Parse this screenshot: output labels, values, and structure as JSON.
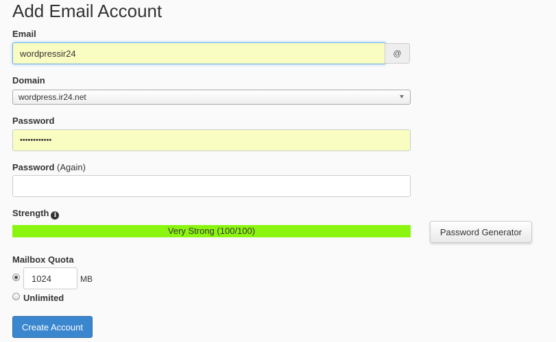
{
  "page": {
    "title": "Add Email Account"
  },
  "email": {
    "label": "Email",
    "value": "wordpressir24",
    "addon": "@"
  },
  "domain": {
    "label": "Domain",
    "selected": "wordpress.ir24.net"
  },
  "password": {
    "label": "Password",
    "value": "••••••••••••"
  },
  "password_again": {
    "label_main": "Password",
    "label_suffix": "(Again)",
    "value": ""
  },
  "strength": {
    "label": "Strength",
    "info_icon": "info-circle-icon",
    "text": "Very Strong (100/100)",
    "score": 100,
    "max": 100,
    "color": "#8cf50f"
  },
  "password_generator": {
    "label": "Password Generator"
  },
  "quota": {
    "label": "Mailbox Quota",
    "value": "1024",
    "unit": "MB",
    "unlimited_label": "Unlimited",
    "selected": "limited"
  },
  "actions": {
    "create_label": "Create Account",
    "primary_color": "#3a86cf"
  }
}
